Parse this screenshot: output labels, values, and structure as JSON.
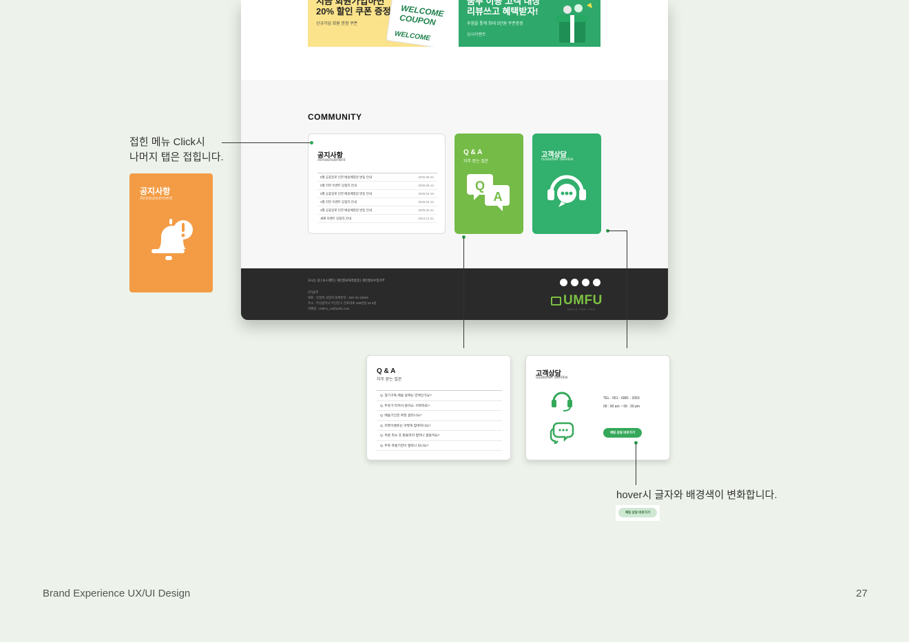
{
  "banners": {
    "yellow": {
      "headline_line1": "지금 회원가입하면",
      "headline_line2": "20% 할인 쿠폰 증정",
      "caption": "신규가입 회원 한정 쿠폰",
      "coupon_line1": "WELCOME",
      "coupon_line2": "COUPON",
      "coupon_bottom": "WELCOME"
    },
    "green": {
      "headline_line1": "움푸 이용 고객 대상",
      "headline_line2": "리뷰쓰고 혜택받자!",
      "caption": "추첨을 통해 최대 5만원 쿠폰증정",
      "caption2": "상시이벤트"
    }
  },
  "community": {
    "title": "COMMUNITY",
    "notice": {
      "title": "공지사항",
      "subtitle": "Announcement",
      "items": [
        {
          "title": "6월 공휴일로 인한 배송예정일 변동 안내",
          "date": "2025.05.21."
        },
        {
          "title": "5월 리뷰 이벤트 당첨자 안내",
          "date": "2025.05.12."
        },
        {
          "title": "5월 공휴일로 인한 배송예정일 변동 안내",
          "date": "2025.04.18."
        },
        {
          "title": "4월 리뷰 이벤트 당첨자 안내",
          "date": "2025.04.12."
        },
        {
          "title": "3월 공휴일로 인한 배송예정일 변동 안내",
          "date": "2025.02.21."
        },
        {
          "title": "새해 이벤트 당첨자 안내",
          "date": "2024.12.31."
        }
      ]
    },
    "qa": {
      "title": "Q & A",
      "subtitle": "자주 묻는 질문"
    },
    "cs": {
      "title": "고객상담",
      "subtitle": "customer Service"
    }
  },
  "footer": {
    "nav": "오시는 길   |   뉴스레터   |   개인정보처리방침   |   개인정보수집거부",
    "company": "(주)움푸",
    "ceo_line": "대표 : 민성혁     사업자 등록번호 : 820-32-16534",
    "address": "주소 : 부산광역시 부산진구 전포대로 189번길 15 6층",
    "email": "이메일 : UMFU_cs@umfu.com",
    "logo_text": "UMFU",
    "logo_tagline": "SMILE FOR YOU"
  },
  "annotations": {
    "click_note_line1": "접힌 메뉴 Click시",
    "click_note_line2": "나머지 탭은 접힙니다.",
    "hover_note": "hover시 글자와 배경색이 변화합니다."
  },
  "expanded_notice": {
    "title": "공지사항",
    "subtitle": "Announcement"
  },
  "expanded_qa": {
    "title": "Q & A",
    "subtitle": "자주 묻는 질문",
    "items": [
      "Q. 정기구독 배송 날짜는 언제인가요?",
      "Q. 두유가 터져서 왔어요. 어떡하죠?",
      "Q. 배송기간은 며칠 걸리나요?",
      "Q. 리뷰이벤트는 어떻게 참여하나요?",
      "Q. 주문 취소 후 환불까지 얼마나 걸릴까요?",
      "Q. 두유 유통기한이 얼마나 되나요?"
    ]
  },
  "expanded_cs": {
    "title": "고객상담",
    "subtitle": "customer Service",
    "tel": "TEL : 051 - 6981 - 3353",
    "hours": "09 : 00 am ~ 06 : 30 pm",
    "button": "채팅 상담 바로가기"
  },
  "hover_button": "채팅 상담 바로가기",
  "page_footer": {
    "left": "Brand Experience UX/UI Design",
    "page_number": "27"
  },
  "colors": {
    "background": "#edf3ea",
    "green_primary": "#32b06d",
    "green_light": "#75bb47",
    "orange": "#f39c45",
    "footer_dark": "#2a2a2a",
    "button_hover": "#cfe8d3"
  }
}
